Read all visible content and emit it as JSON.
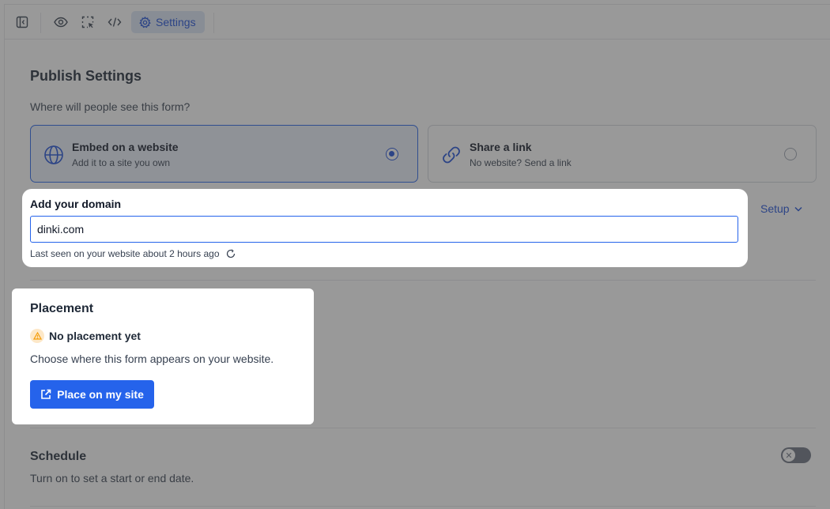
{
  "toolbar": {
    "settings_label": "Settings"
  },
  "publish": {
    "title": "Publish Settings",
    "question": "Where will people see this form?",
    "options": [
      {
        "title": "Embed on a website",
        "subtitle": "Add it to a site you own",
        "selected": true
      },
      {
        "title": "Share a link",
        "subtitle": "No website? Send a link",
        "selected": false
      }
    ],
    "setup_label": "Setup"
  },
  "domain": {
    "label": "Add your domain",
    "value": "dinki.com",
    "last_seen": "Last seen on your website about 2 hours ago"
  },
  "placement": {
    "title": "Placement",
    "status": "No placement yet",
    "description": "Choose where this form appears on your website.",
    "button_label": "Place on my site"
  },
  "schedule": {
    "title": "Schedule",
    "subtitle": "Turn on to set a start or end date."
  },
  "colors": {
    "accent": "#2563eb",
    "warning_bg": "#fde8c8",
    "warning_fg": "#f59e0b"
  }
}
